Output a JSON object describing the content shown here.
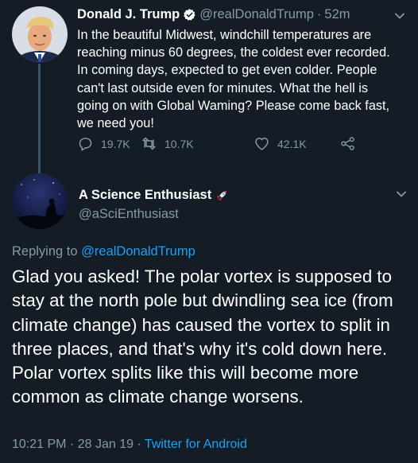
{
  "tweet": {
    "display_name": "Donald J. Trump",
    "handle": "@realDonaldTrump",
    "separator": "·",
    "time": "52m",
    "text": "In the beautiful Midwest, windchill temperatures are reaching minus 60 degrees, the coldest ever recorded. In coming days, expected to get even colder. People can't last outside even for minutes. What the hell is going on with Global Waming? Please come back fast, we need you!",
    "replies": "19.7K",
    "retweets": "10.7K",
    "likes": "42.1K",
    "icons": [
      "verified-badge-icon",
      "reply-icon",
      "retweet-icon",
      "like-icon",
      "share-icon",
      "chevron-down-icon"
    ]
  },
  "reply": {
    "display_name": "A Science Enthusiast",
    "handle": "@aSciEnthusiast",
    "replying_prefix": "Replying to",
    "replying_handle": "@realDonaldTrump",
    "text": "Glad you asked! The polar vortex is supposed to stay at the north pole but dwindling sea ice (from climate change) has caused the vortex to split in three places, and that's why it's cold down here. Polar vortex splits like this will become more common as climate change worsens.",
    "timestamp": "10:21 PM · 28 Jan 19 ·",
    "source": "Twitter for Android",
    "icons": [
      "rocket-emoji-icon",
      "chevron-down-icon"
    ]
  },
  "colors": {
    "background": "#141d26",
    "text_primary": "#ffffff",
    "text_secondary": "#8899a6",
    "link": "#1da1f2",
    "thread_line": "#3d5466"
  }
}
